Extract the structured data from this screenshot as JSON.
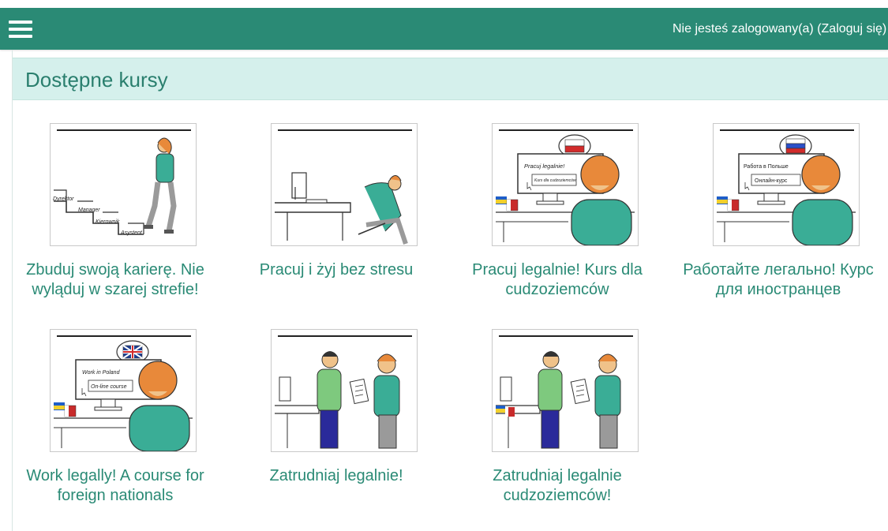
{
  "topbar": {
    "menu_icon": "hamburger-menu-icon",
    "login_status_prefix": "Nie jesteś zalogowany(a) (",
    "login_link": "Zaloguj się",
    "login_status_suffix": ")"
  },
  "page": {
    "title": "Dostępne kursy"
  },
  "courses": [
    {
      "title": "Zbuduj swoją karierę. Nie wyląduj w szarej strefie!",
      "image_labels": [
        "Dyrektor",
        "Manager",
        "Kierownik",
        "Asystent"
      ]
    },
    {
      "title": "Pracuj i żyj bez stresu"
    },
    {
      "title": "Pracuj legalnie! Kurs dla cudzoziemców",
      "image_labels": [
        "Pracuj legalnie!",
        "Kurs dla cudzoziemców"
      ]
    },
    {
      "title": "Работайте легально! Курс для иностранцев",
      "image_labels": [
        "Работа в Польше",
        "Онлайн-курс"
      ]
    },
    {
      "title": "Work legally! A course for foreign nationals",
      "image_labels": [
        "Work in Poland",
        "On-line course"
      ]
    },
    {
      "title": "Zatrudniaj legalnie!"
    },
    {
      "title": "Zatrudniaj legalnie cudzoziemców!"
    }
  ],
  "colors": {
    "topbar": "#2a8a75",
    "header_band": "#d5f0ec",
    "link": "#2a8a75",
    "title": "#2a7f6e"
  }
}
